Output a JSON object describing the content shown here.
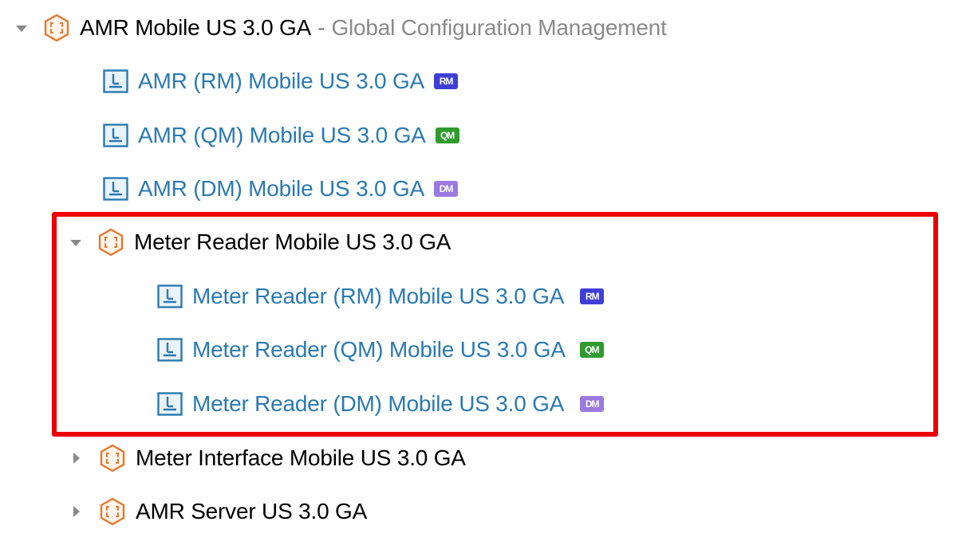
{
  "tree": {
    "root": {
      "name": "AMR Mobile US 3.0 GA",
      "separator": "-",
      "suffix": "Global Configuration Management",
      "expanded": true,
      "icon": "configuration-icon"
    },
    "root_children": [
      {
        "label": "AMR (RM) Mobile US 3.0 GA",
        "badge": "RM",
        "icon": "component-icon"
      },
      {
        "label": "AMR (QM) Mobile US 3.0 GA",
        "badge": "QM",
        "icon": "component-icon"
      },
      {
        "label": "AMR (DM) Mobile US 3.0 GA",
        "badge": "DM",
        "icon": "component-icon"
      }
    ],
    "meter_reader": {
      "name": "Meter Reader Mobile US 3.0 GA",
      "expanded": true,
      "icon": "configuration-icon",
      "children": [
        {
          "label": "Meter Reader (RM) Mobile US 3.0 GA",
          "badge": "RM",
          "icon": "component-icon"
        },
        {
          "label": "Meter Reader (QM) Mobile US 3.0 GA",
          "badge": "QM",
          "icon": "component-icon"
        },
        {
          "label": "Meter Reader (DM) Mobile US 3.0 GA",
          "badge": "DM",
          "icon": "component-icon"
        }
      ]
    },
    "collapsed_nodes": [
      {
        "name": "Meter Interface Mobile US 3.0 GA",
        "expanded": false,
        "icon": "configuration-icon"
      },
      {
        "name": "AMR Server US 3.0 GA",
        "expanded": false,
        "icon": "configuration-icon"
      }
    ]
  },
  "colors": {
    "link": "#2a7ab2",
    "config_icon": "#e8772e",
    "component_icon": "#2a7ab2",
    "badge_rm": "#3f3fd6",
    "badge_qm": "#2f9b2f",
    "badge_dm": "#9a7ae0",
    "highlight": "#ee0000"
  }
}
